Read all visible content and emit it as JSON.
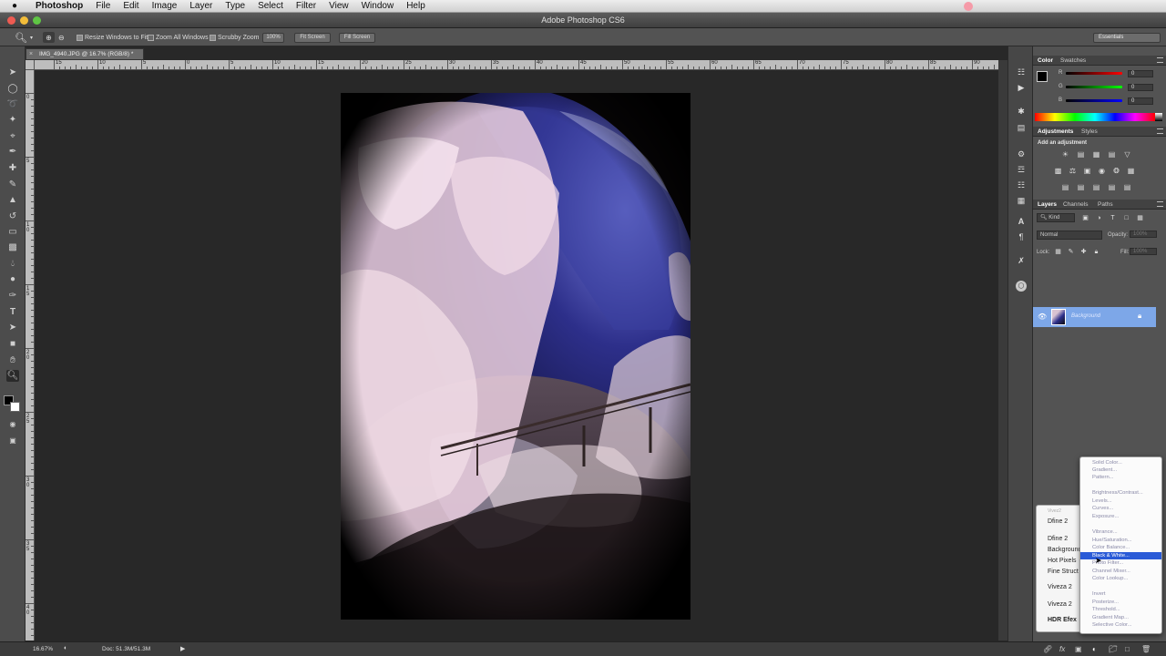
{
  "menubar": {
    "app": "Photoshop",
    "items": [
      "File",
      "Edit",
      "Image",
      "Layer",
      "Type",
      "Select",
      "Filter",
      "View",
      "Window",
      "Help"
    ]
  },
  "window": {
    "title": "Adobe Photoshop CS6"
  },
  "options": {
    "resize_windows": "Resize Windows to Fit",
    "zoom_all": "Zoom All Windows",
    "scrubby": "Scrubby Zoom",
    "zoom_100": "100%",
    "fit_screen": "Fit Screen",
    "fill_screen": "Fill Screen",
    "workspace": "Essentials"
  },
  "document": {
    "tab": "IMG_4940.JPG @ 16.7% (RGB/8) *"
  },
  "ruler": {
    "h_labels": [
      "15",
      "10",
      "5",
      "0",
      "5",
      "10",
      "15",
      "20",
      "25",
      "30",
      "35",
      "40",
      "45",
      "50",
      "55",
      "60",
      "65",
      "70",
      "75",
      "80",
      "85",
      "90"
    ],
    "v_labels": [
      "0",
      "5",
      "1 0",
      "1 5",
      "2 0",
      "2 5",
      "3 0",
      "3 5",
      "4 0"
    ]
  },
  "color_panel": {
    "tabs": [
      "Color",
      "Swatches"
    ],
    "channels": [
      {
        "label": "R",
        "value": "0"
      },
      {
        "label": "G",
        "value": "0"
      },
      {
        "label": "B",
        "value": "0"
      }
    ]
  },
  "adjustments_panel": {
    "tabs": [
      "Adjustments",
      "Styles"
    ],
    "heading": "Add an adjustment"
  },
  "layers_panel": {
    "tabs": [
      "Layers",
      "Channels",
      "Paths"
    ],
    "kind": "Kind",
    "blend_mode": "Normal",
    "opacity_label": "Opacity:",
    "opacity_value": "100%",
    "lock_label": "Lock:",
    "fill_label": "Fill:",
    "fill_value": "100%",
    "layer_name": "Background"
  },
  "status": {
    "zoom": "16.67%",
    "doc": "Doc: 51.3M/51.3M"
  },
  "filter_submenu": {
    "items": [
      "Vivez2",
      "Dfine 2",
      "Dfine 2",
      "Background",
      "Hot Pixels",
      "Fine Struct",
      "Viveza 2",
      "Viveza 2",
      "HDR Efex"
    ]
  },
  "adjustment_menu": {
    "items": [
      "Solid Color...",
      "Gradient...",
      "Pattern...",
      "Brightness/Contrast...",
      "Levels...",
      "Curves...",
      "Exposure...",
      "Vibrance...",
      "Hue/Saturation...",
      "Color Balance...",
      "Black & White...",
      "Photo Filter...",
      "Channel Mixer...",
      "Color Lookup...",
      "Invert",
      "Posterize...",
      "Threshold...",
      "Gradient Map...",
      "Selective Color..."
    ],
    "highlighted": "Black & White..."
  },
  "colors": {
    "selection": "#2a5bd7",
    "layer_selected": "#7da7e8",
    "panel": "#535353",
    "canvas": "#282828"
  }
}
